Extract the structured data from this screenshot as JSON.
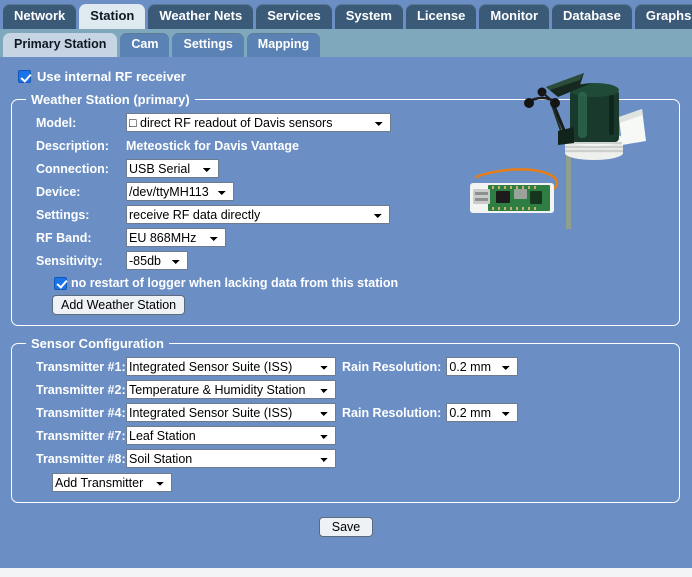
{
  "main_tabs": [
    {
      "label": "Network",
      "active": false
    },
    {
      "label": "Station",
      "active": true
    },
    {
      "label": "Weather Nets",
      "active": false
    },
    {
      "label": "Services",
      "active": false
    },
    {
      "label": "System",
      "active": false
    },
    {
      "label": "License",
      "active": false
    },
    {
      "label": "Monitor",
      "active": false
    },
    {
      "label": "Database",
      "active": false
    },
    {
      "label": "Graphs",
      "active": false
    }
  ],
  "sub_tabs": [
    {
      "label": "Primary Station",
      "active": true
    },
    {
      "label": "Cam",
      "active": false
    },
    {
      "label": "Settings",
      "active": false
    },
    {
      "label": "Mapping",
      "active": false
    }
  ],
  "internal_rf": {
    "label": "Use internal RF receiver",
    "checked": true
  },
  "weather_station": {
    "legend": "Weather Station (primary)",
    "model": {
      "label": "Model:",
      "value": "□ direct RF readout of Davis sensors"
    },
    "description": {
      "label": "Description:",
      "value": "Meteostick for Davis Vantage"
    },
    "connection": {
      "label": "Connection:",
      "value": "USB Serial"
    },
    "device": {
      "label": "Device:",
      "value": "/dev/ttyMH113"
    },
    "settings": {
      "label": "Settings:",
      "value": "receive RF data directly"
    },
    "rf_band": {
      "label": "RF Band:",
      "value": "EU 868MHz"
    },
    "sensitivity": {
      "label": "Sensitivity:",
      "value": "-85db"
    },
    "no_restart": {
      "label": "no restart of logger when lacking data from this station",
      "checked": true
    },
    "add_button": "Add Weather Station"
  },
  "sensor_config": {
    "legend": "Sensor Configuration",
    "rain_label": "Rain Resolution:",
    "transmitters": [
      {
        "label": "Transmitter #1:",
        "value": "Integrated Sensor Suite (ISS)",
        "rain": "0.2 mm"
      },
      {
        "label": "Transmitter #2:",
        "value": "Temperature & Humidity Station",
        "rain": null
      },
      {
        "label": "Transmitter #4:",
        "value": "Integrated Sensor Suite (ISS)",
        "rain": "0.2 mm"
      },
      {
        "label": "Transmitter #7:",
        "value": "Leaf Station",
        "rain": null
      },
      {
        "label": "Transmitter #8:",
        "value": "Soil Station",
        "rain": null
      }
    ],
    "add_transmitter": "Add Transmitter"
  },
  "save_button": "Save",
  "illustration": {
    "name": "davis-vantage-iss-and-meteostick-photo",
    "alt": "Davis Vantage integrated sensor suite with anemometer and Meteostick USB receiver"
  },
  "colors": {
    "page_background": "#6b8fc4",
    "tab_inactive": "#3a5a78",
    "tab_active": "#dfe9f0",
    "subtab_bar": "#7fa8bd",
    "subtab_inactive": "#5b82b5",
    "subtab_active": "#c6d4e4",
    "checkbox_accent": "#1a73e8",
    "fieldset_border": "#ffffff",
    "label_text": "#ffffff"
  }
}
